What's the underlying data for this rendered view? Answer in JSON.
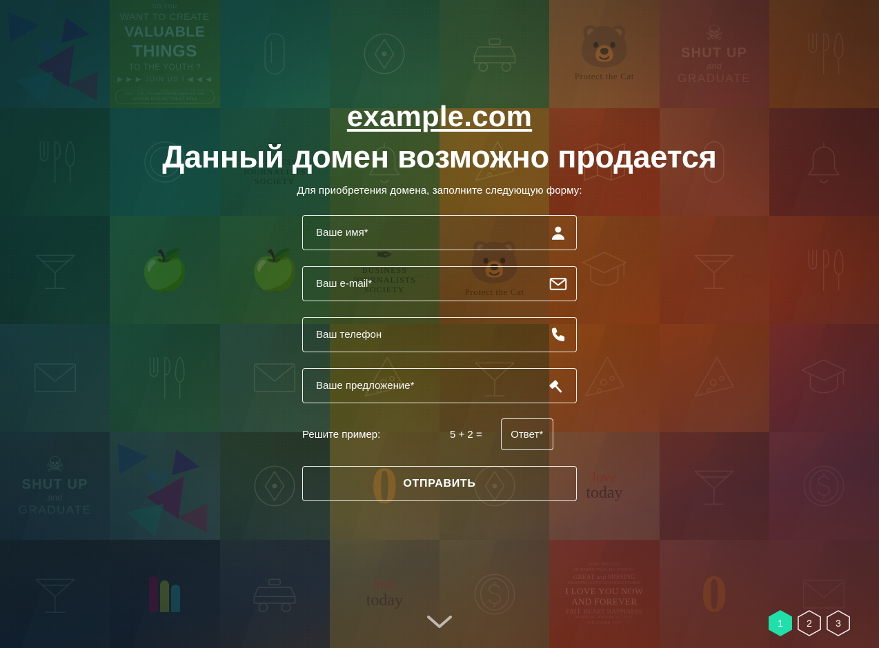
{
  "header": {
    "domain": "example.com",
    "headline": "Данный домен возможно продается",
    "subtitle": "Для приобретения домена, заполните следующую форму:"
  },
  "form": {
    "fields": [
      {
        "name": "name",
        "placeholder": "Ваше имя*",
        "value": "",
        "icon": "person-icon"
      },
      {
        "name": "email",
        "placeholder": "Ваш e-mail*",
        "value": "",
        "icon": "envelope-icon"
      },
      {
        "name": "phone",
        "placeholder": "Ваш телефон",
        "value": "",
        "icon": "phone-icon"
      },
      {
        "name": "offer",
        "placeholder": "Ваше предложение*",
        "value": "",
        "icon": "gavel-icon"
      }
    ],
    "captcha": {
      "label": "Решите пример:",
      "question": "5 + 2 =",
      "answer_placeholder": "Ответ*",
      "answer_value": ""
    },
    "submit_label": "ОТПРАВИТЬ"
  },
  "pagination": {
    "items": [
      {
        "label": "1",
        "active": true
      },
      {
        "label": "2",
        "active": false
      },
      {
        "label": "3",
        "active": false
      }
    ],
    "active_color": "#1ee0a8"
  },
  "scroll_hint": {
    "icon": "chevron-down-icon"
  },
  "colors": {
    "text": "#ffffff",
    "field_border": "rgba(255,255,255,0.92)",
    "accent": "#1ee0a8"
  },
  "background": {
    "tiles": [
      {
        "row": 1,
        "col": 1,
        "kind": "triangles",
        "base": "#2f7f86"
      },
      {
        "row": 1,
        "col": 2,
        "kind": "valuable",
        "base": "#6f9a4a"
      },
      {
        "row": 1,
        "col": 3,
        "kind": "paperclip",
        "base": "#2e8a85"
      },
      {
        "row": 1,
        "col": 4,
        "kind": "compass",
        "base": "#3a7f6a"
      },
      {
        "row": 1,
        "col": 5,
        "kind": "taxi",
        "base": "#4a7a52"
      },
      {
        "row": 1,
        "col": 6,
        "kind": "bear",
        "base": "#b4784f"
      },
      {
        "row": 1,
        "col": 7,
        "kind": "shutup",
        "base": "#a5575a"
      },
      {
        "row": 1,
        "col": 8,
        "kind": "cutlery",
        "base": "#b1742d"
      },
      {
        "row": 2,
        "col": 1,
        "kind": "cutlery",
        "base": "#2a6f5c"
      },
      {
        "row": 2,
        "col": 2,
        "kind": "rings",
        "base": "#2b8483"
      },
      {
        "row": 2,
        "col": 3,
        "kind": "bjs",
        "base": "#3b7f6e"
      },
      {
        "row": 2,
        "col": 4,
        "kind": "bell",
        "base": "#6a8a4c"
      },
      {
        "row": 2,
        "col": 5,
        "kind": "pizza",
        "base": "#c08a2a"
      },
      {
        "row": 2,
        "col": 6,
        "kind": "map",
        "base": "#bb4a26"
      },
      {
        "row": 2,
        "col": 7,
        "kind": "paperclip",
        "base": "#b06a54"
      },
      {
        "row": 2,
        "col": 8,
        "kind": "bell",
        "base": "#8a3f42"
      },
      {
        "row": 3,
        "col": 1,
        "kind": "cocktail",
        "base": "#27615c"
      },
      {
        "row": 3,
        "col": 2,
        "kind": "apple",
        "base": "#4e8d6a"
      },
      {
        "row": 3,
        "col": 3,
        "kind": "apple",
        "base": "#4f8f64"
      },
      {
        "row": 3,
        "col": 4,
        "kind": "bjs",
        "base": "#6e8a4e"
      },
      {
        "row": 3,
        "col": 5,
        "kind": "bear",
        "base": "#b07a3a"
      },
      {
        "row": 3,
        "col": 6,
        "kind": "graduate",
        "base": "#c2762c"
      },
      {
        "row": 3,
        "col": 7,
        "kind": "cocktail",
        "base": "#b36a3c"
      },
      {
        "row": 3,
        "col": 8,
        "kind": "cutlery",
        "base": "#ae5a3a"
      },
      {
        "row": 4,
        "col": 1,
        "kind": "envelope",
        "base": "#3f6f84"
      },
      {
        "row": 4,
        "col": 2,
        "kind": "cutlery",
        "base": "#3a8070"
      },
      {
        "row": 4,
        "col": 3,
        "kind": "envelope",
        "base": "#4a7f8a"
      },
      {
        "row": 4,
        "col": 4,
        "kind": "pizza",
        "base": "#8d8a3e"
      },
      {
        "row": 4,
        "col": 5,
        "kind": "cocktail",
        "base": "#8a7a3a"
      },
      {
        "row": 4,
        "col": 6,
        "kind": "pizza",
        "base": "#c9832c"
      },
      {
        "row": 4,
        "col": 7,
        "kind": "pizza",
        "base": "#c07a30"
      },
      {
        "row": 4,
        "col": 8,
        "kind": "graduate",
        "base": "#a75252"
      },
      {
        "row": 5,
        "col": 1,
        "kind": "shutup",
        "base": "#3a5a7e"
      },
      {
        "row": 5,
        "col": 2,
        "kind": "triangles",
        "base": "#4a6f8c"
      },
      {
        "row": 5,
        "col": 3,
        "kind": "compass",
        "base": "#3a5a56"
      },
      {
        "row": 5,
        "col": 4,
        "kind": "zero",
        "base": "#9a8f4a"
      },
      {
        "row": 5,
        "col": 5,
        "kind": "compass",
        "base": "#8a8a44"
      },
      {
        "row": 5,
        "col": 6,
        "kind": "love",
        "base": "#b89a62"
      },
      {
        "row": 5,
        "col": 7,
        "kind": "cocktail",
        "base": "#9a5536"
      },
      {
        "row": 5,
        "col": 8,
        "kind": "dollar",
        "base": "#b06060"
      },
      {
        "row": 6,
        "col": 1,
        "kind": "cocktail",
        "base": "#2c3f52"
      },
      {
        "row": 6,
        "col": 2,
        "kind": "m-logo",
        "base": "#26354a"
      },
      {
        "row": 6,
        "col": 3,
        "kind": "taxi",
        "base": "#34425a"
      },
      {
        "row": 6,
        "col": 4,
        "kind": "love",
        "base": "#8f8a52"
      },
      {
        "row": 6,
        "col": 5,
        "kind": "dollar",
        "base": "#93924e"
      },
      {
        "row": 6,
        "col": 6,
        "kind": "iloveyou",
        "base": "#c25a22"
      },
      {
        "row": 6,
        "col": 7,
        "kind": "zero",
        "base": "#b8765a"
      },
      {
        "row": 6,
        "col": 8,
        "kind": "envelope",
        "base": "#b06a62"
      }
    ],
    "posters": {
      "valuable": {
        "l1": "DO YOU",
        "l2": "WANT TO CREATE",
        "l3": "VALUABLE",
        "l4": "THINGS",
        "l5": "TO THE YOUTH ?",
        "l6": "▶ ▶ ▶  JOIN US !  ◀ ◀ ◀",
        "l7": "VIET YOUTH ENTREPRENEURS 5tE GRAND RECRUITMENT 2013"
      },
      "shutup": {
        "l1": "SHUT UP",
        "l2": "and",
        "l3": "GRADUATE"
      },
      "bear": {
        "caption": "Protect the Cat"
      },
      "bjs": {
        "l1": "BUSINESS",
        "l2": "JOURNALISTS",
        "l3": "SOCIETY"
      },
      "love": {
        "l1": "love",
        "l2": "today"
      },
      "iloveyou": {
        "r1": "SOUL        DESTINY",
        "r2": "MORNING TALK   MY SPECIAL",
        "r3": "GREAT and MISSING",
        "r4": "MORNING LOVE    UNFORGETTABLE",
        "r5": "I LOVE YOU NOW AND FOREVER",
        "r6": "FATE  HEART  HAPPINESS",
        "r7": "MORNING KISS  BEAUTIFUL",
        "r8": "TOGETHER YOU"
      }
    }
  }
}
